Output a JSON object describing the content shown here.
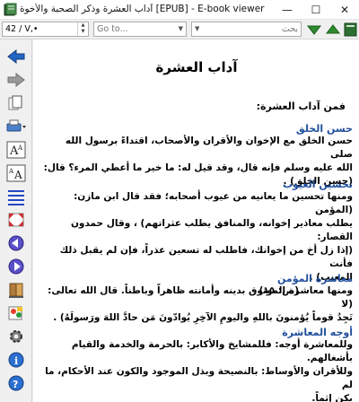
{
  "window": {
    "title": "آداب العشرة وذكر الصحبة والأخوة [EPUB] - E-book viewer",
    "minimize": "—",
    "maximize": "☐",
    "close": "✕"
  },
  "toolbar": {
    "position_value": "42 / V,•",
    "goto_placeholder": "Go to...",
    "search_placeholder": "بحث",
    "icons": [
      "search-down-icon",
      "search-up-icon",
      "library-icon"
    ]
  },
  "sidebar": {
    "icons": [
      "back-icon",
      "forward-icon",
      "copy-icon",
      "print-icon",
      "font-larger-icon",
      "font-smaller-icon",
      "toc-icon",
      "fullscreen-icon",
      "previous-page-icon",
      "next-page-icon",
      "bookmark-icon",
      "reference-icon",
      "preferences-icon",
      "metadata-icon",
      "help-icon"
    ]
  },
  "book": {
    "title": "آداب العشرة",
    "intro": "فمن آداب العشرة:",
    "sections": [
      {
        "heading": "حسن الخلق",
        "lines": [
          "حسن الخلق مع الإخوان والأقران والأصحاب، اقتداءً برسول الله صلى",
          "الله عليه وسلم فإنه قال، وقد قيل له: ما خير ما أعطي المرء؟ قال:",
          "(حسن الخلق) ."
        ]
      },
      {
        "heading": "تحسين العيوب",
        "lines": [
          "ومنها تحسين ما يعانيه من عيوب أصحابه؛ فقد قال ابن مازن: (المؤمن",
          "يطلب معاذير إخوانه، والمنافق يطلب عثراتهم) ، وقال حمدون القصار:",
          "(إذا زل أخ من إخوانك، فاطلب له تسعين عذراً، فإن لم يقبل ذلك فأنت",
          "المعيب) .",
          "(ص: ١٥)"
        ]
      },
      {
        "heading": "معاشرة المؤمن",
        "lines": [
          "ومنها معاشرة الموثوق بدينه وأمانته ظاهراً وباطناً. قال الله تعالى: (لا",
          "تَجِدُ قوماً يُؤمنونَ باللهِ واليومِ الآخِرِ يُوادّونَ مَن حادَّ اللهَ ورَسولَهُ) ."
        ]
      },
      {
        "heading": "أوجه المعاشرة",
        "lines": [
          "وللمعاشرة أوجه: فللمشايخ والأكابر: بالحرمة والخدمة والقيام",
          "بأشغالهم.",
          "وللأقران والأوساط: بالنصيحة وبذل الموجود والكون عند الأحكام، ما لم",
          "يكن إثماً."
        ]
      }
    ]
  }
}
